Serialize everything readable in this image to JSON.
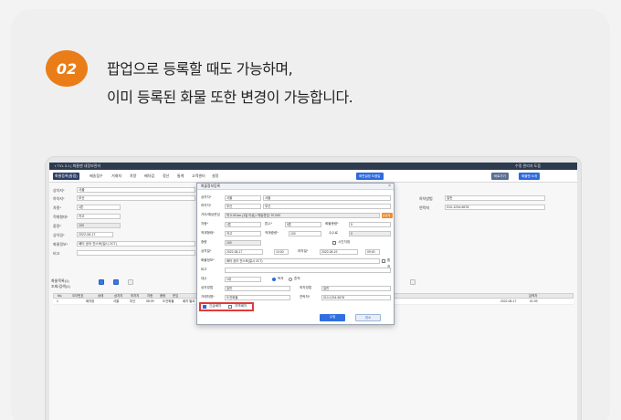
{
  "step": {
    "number": "02"
  },
  "headline": {
    "line1": "팝업으로 등록할 때도 가능하며,",
    "line2": "이미 등록된 화물 또한 변경이 가능합니다."
  },
  "app": {
    "title": "▪ TVL 3.1 | 화물맨 내정보관리",
    "title_right": "수정 관리자 도움",
    "toolbar": {
      "items": [
        "화물등록(통합)",
        "배송접수",
        "거래처",
        "차량",
        "배차검",
        "정산",
        "통계",
        "고객센터",
        "설정"
      ],
      "right_buttons": [
        "화면설정 도움말",
        "바로가기",
        "화물맨 소개"
      ]
    },
    "form_left": {
      "rows": [
        {
          "label": "상차지*",
          "value": "서울"
        },
        {
          "label": "하차지*",
          "value": "부산"
        },
        {
          "label": "차종*",
          "value": "1톤"
        },
        {
          "label": "적재형태*",
          "value": "카고"
        },
        {
          "label": "중량*",
          "value": "100"
        },
        {
          "label": "상차일*",
          "value": "2022-08-17"
        },
        {
          "label": "화물정보*",
          "value": "배터 공아 전스토(일시 2CT)"
        },
        {
          "label": "비고",
          "value": ""
        }
      ]
    },
    "grid": {
      "label_count": "화물목록(1)",
      "label_filter": "조회/검색(1)",
      "headers": [
        "No.",
        "오더번호",
        "상태",
        "상차지",
        "하차지",
        "차종",
        "중량",
        "운임",
        "입력자"
      ],
      "row": [
        "1",
        "배차완",
        "서울",
        "부산",
        "08:09",
        "도전화물",
        "배차 필요",
        "2022-08-17",
        "01:09"
      ]
    },
    "right_panel": {
      "labels": [
        "하차방법",
        "연락처"
      ],
      "values": [
        "일반",
        "010-1234-5678"
      ]
    }
  },
  "dialog": {
    "title": "화물정보등록",
    "close_icon": "close-icon",
    "rows": {
      "pickup_label": "상차지*",
      "pickup_value1": "서울",
      "pickup_value2": "서울",
      "drop_label": "하차지*",
      "drop_value1": "부산",
      "drop_value2": "부산",
      "distance_label": "거리/예상운임",
      "distance_value": "약 0.00 km (1일 이상) / 예상운임: 97,000",
      "distance_tag": "운임계산",
      "vehicle_label": "차종*",
      "vehicle_value": "1톤",
      "tonnage_label": "톤수*",
      "tonnage_value": "5톤",
      "cargo_qty_label": "화물총량*",
      "cargo_qty_value": "5",
      "load_type_label": "적재형태*",
      "load_type_value": "카고",
      "load_weight_label": "적재중량*",
      "load_weight_value": "100",
      "fee_label": "수수료",
      "fee_value": "0",
      "weight_label": "중량",
      "weight_value": "100",
      "time_label": "시간지정",
      "pickup_date_label": "상차일*",
      "pickup_date_value": "2022-08-17",
      "pickup_time_value": "10:00",
      "drop_date_label": "하차일*",
      "drop_date_value": "2022-08-19",
      "drop_time_value": "09:00",
      "cargo_info_label": "화물정보*",
      "cargo_info_value": "배터 공아 전스토(일시 2CT)",
      "consol_label": "합짐",
      "memo_label": "비고",
      "memo_value": "",
      "payment_label": "대수",
      "payment_value": "1대",
      "pay_option1": "독차",
      "pay_option2": "혼적",
      "load_method_label": "상차방법",
      "load_method_value": "일반",
      "unload_method_label": "하차방법",
      "unload_method_value": "일반",
      "client_label": "거래처명*",
      "client_value": "도전화물",
      "contact_label": "연락처*",
      "contact_value": "010-1234-5678",
      "check1_label": "긴급배차",
      "check2_label": "지역배차"
    },
    "buttons": {
      "save": "수정",
      "cancel": "취소"
    }
  },
  "colors": {
    "accent_orange": "#ea7d17",
    "highlight_red": "#e23a3a",
    "primary_blue": "#2f6fdf"
  }
}
